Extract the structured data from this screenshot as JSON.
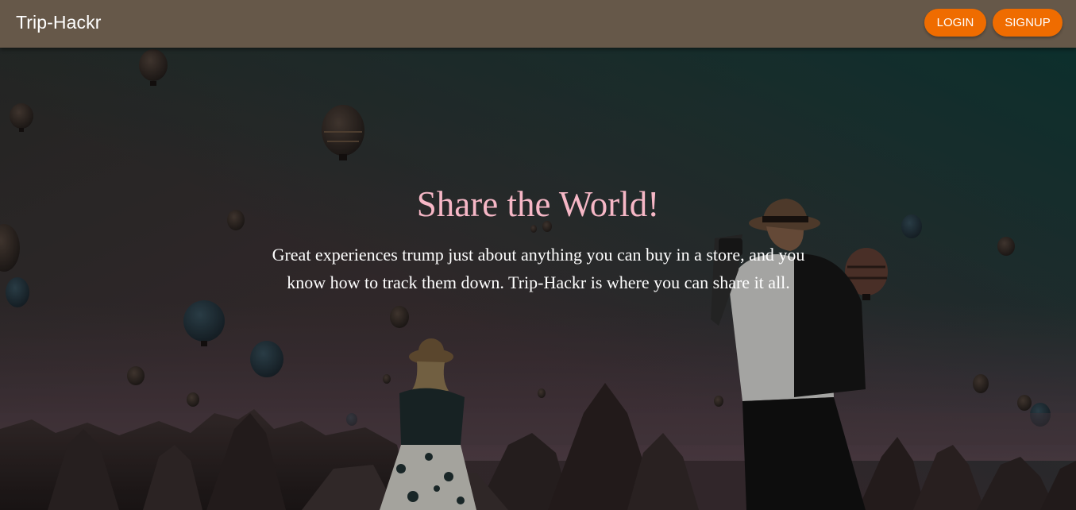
{
  "header": {
    "brand": "Trip-Hackr",
    "login_label": "LOGIN",
    "signup_label": "SIGNUP"
  },
  "hero": {
    "headline": "Share the World!",
    "tagline": "Great experiences trump just about anything you can buy in a store, and you know how to track them down. Trip-Hackr is where you can share it all."
  },
  "colors": {
    "topbar": "#665849",
    "button": "#ef6c00",
    "headline": "#f6b7c6",
    "text": "#ffffff"
  }
}
